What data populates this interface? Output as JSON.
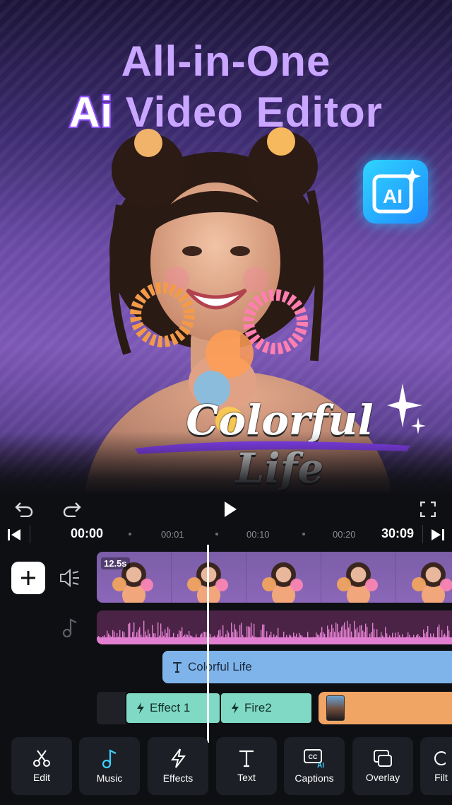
{
  "hero": {
    "headline_line1": "All-in-One",
    "headline_ai": "Ai",
    "headline_line2_rest": " Video Editor",
    "ai_badge_label": "AI",
    "overlay_title": "Colorful Life"
  },
  "player": {
    "current_time": "00:00",
    "total_time": "30:09",
    "ticks": [
      "00:01",
      "00:10",
      "00:20"
    ]
  },
  "tracks": {
    "video_clip_duration": "12.5s",
    "text_clip_label": "Colorful Life",
    "effect_clips": [
      "Effect 1",
      "Fire2"
    ]
  },
  "tools": [
    {
      "label": "Edit",
      "icon": "scissors-icon"
    },
    {
      "label": "Music",
      "icon": "music-note-icon"
    },
    {
      "label": "Effects",
      "icon": "lightning-icon"
    },
    {
      "label": "Text",
      "icon": "text-icon"
    },
    {
      "label": "Captions",
      "icon": "captions-ai-icon"
    },
    {
      "label": "Overlay",
      "icon": "overlay-icon"
    },
    {
      "label": "Filt",
      "icon": "filter-icon"
    }
  ],
  "colors": {
    "accent_purple": "#c9a6ff",
    "ai_badge": "#1e8cff",
    "text_track": "#7fb4ea",
    "effect_track": "#7fd9c4",
    "overlay_track": "#f0a565",
    "audio_wave": "#e37fd0"
  }
}
